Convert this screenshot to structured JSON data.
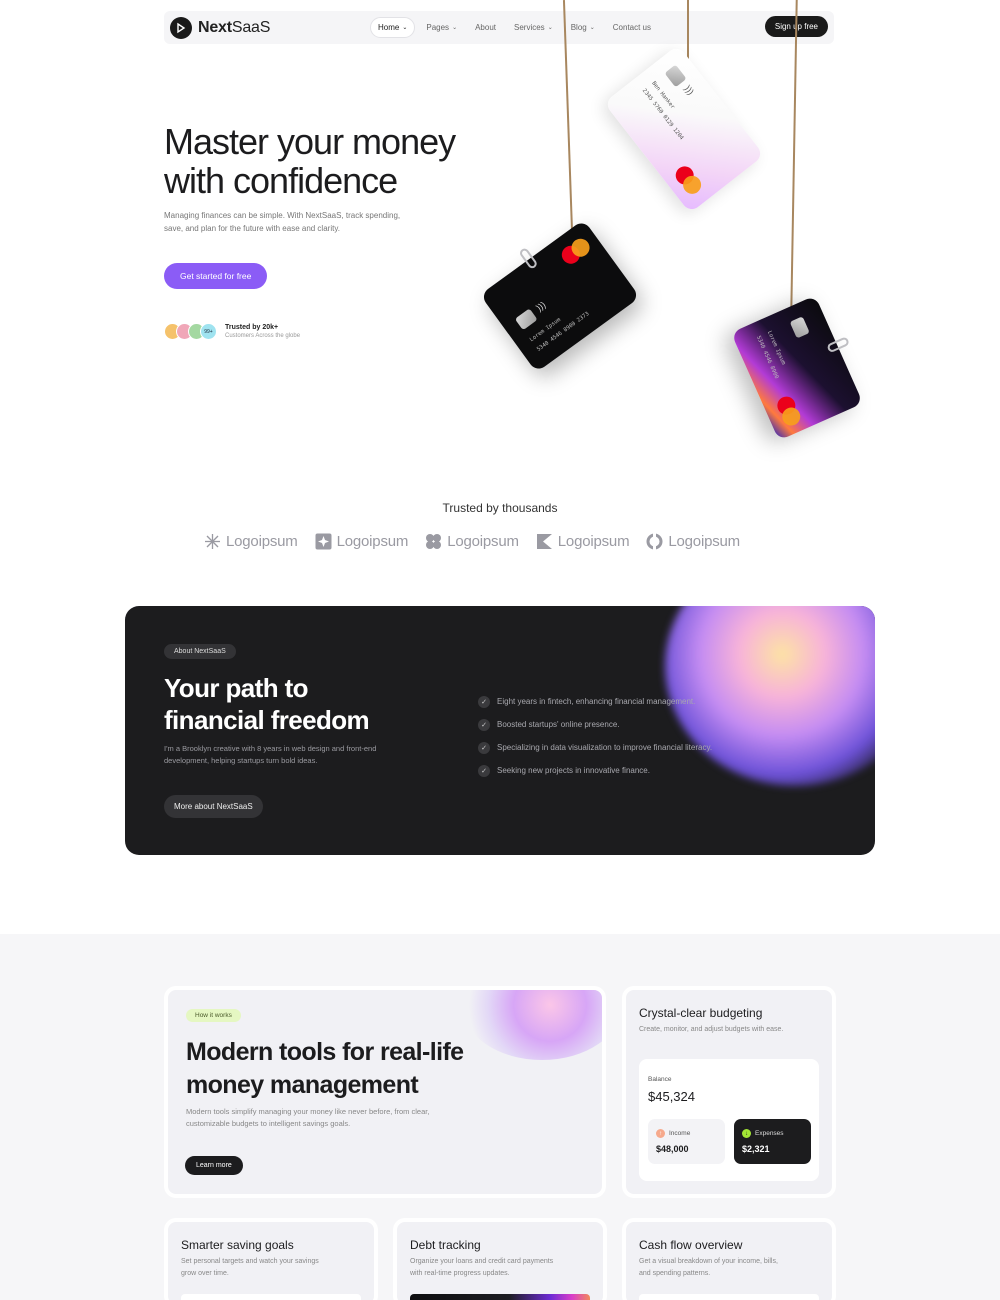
{
  "nav": {
    "logo_bold": "Next",
    "logo_light": "SaaS",
    "links": [
      {
        "label": "Home",
        "has_dropdown": true,
        "active": true
      },
      {
        "label": "Pages",
        "has_dropdown": true,
        "active": false
      },
      {
        "label": "About",
        "has_dropdown": false,
        "active": false
      },
      {
        "label": "Services",
        "has_dropdown": true,
        "active": false
      },
      {
        "label": "Blog",
        "has_dropdown": true,
        "active": false
      },
      {
        "label": "Contact us",
        "has_dropdown": false,
        "active": false
      }
    ],
    "signup_label": "Sign up free"
  },
  "hero": {
    "title_line1": "Master your money",
    "title_line2": "with confidence",
    "subtitle": "Managing finances can be simple. With NextSaaS, track spending, save, and plan for the future with ease and clarity.",
    "cta_label": "Get started for free",
    "avatar_more": "99+",
    "trusted_title": "Trusted by 20k+",
    "trusted_sub": "Customers Across the globe"
  },
  "cards": {
    "light": {
      "holder": "Ben Hanker",
      "number": "2345 5760 0129 1204"
    },
    "dark1": {
      "holder": "Lorem Ipsum",
      "number": "5340 4546 8900 2373"
    },
    "dark2": {
      "holder": "Lorem Ipsum",
      "number": "5340 4546 8900"
    }
  },
  "trusted": {
    "heading": "Trusted by thousands",
    "logos": [
      "Logoipsum",
      "Logoipsum",
      "Logoipsum",
      "Logoipsum",
      "Logoipsum"
    ]
  },
  "about": {
    "badge": "About NextSaaS",
    "title_line1": "Your path to",
    "title_line2": "financial freedom",
    "subtitle": "I'm a Brooklyn creative with 8 years in web design and front-end development, helping startups turn bold ideas.",
    "button_label": "More about NextSaaS",
    "checks": [
      "Eight years in fintech, enhancing financial management.",
      "Boosted startups' online presence.",
      "Specializing in data visualization to improve financial literacy.",
      "Seeking new projects in innovative finance."
    ]
  },
  "features": {
    "main": {
      "badge": "How it works",
      "title_line1": "Modern tools for real-life",
      "title_line2": "money management",
      "subtitle": "Modern tools simplify managing your money like never before, from clear, customizable budgets to intelligent savings goals.",
      "button_label": "Learn more"
    },
    "budget": {
      "title": "Crystal-clear budgeting",
      "subtitle": "Create, monitor, and adjust budgets with ease.",
      "balance_label": "Balance",
      "balance_value": "$45,324",
      "income_label": "Income",
      "income_value": "$48,000",
      "expenses_label": "Expenses",
      "expenses_value": "$2,321"
    },
    "saving": {
      "title": "Smarter saving goals",
      "subtitle": "Set personal targets and watch your savings grow over time."
    },
    "debt": {
      "title": "Debt tracking",
      "subtitle": "Organize your loans and credit card payments with real-time progress updates."
    },
    "cash": {
      "title": "Cash flow overview",
      "subtitle": "Get a visual breakdown of your income, bills, and spending patterns."
    }
  },
  "colors": {
    "accent": "#8b5cf6",
    "dark": "#1c1c1e",
    "badge_green": "#e5f7c2"
  }
}
